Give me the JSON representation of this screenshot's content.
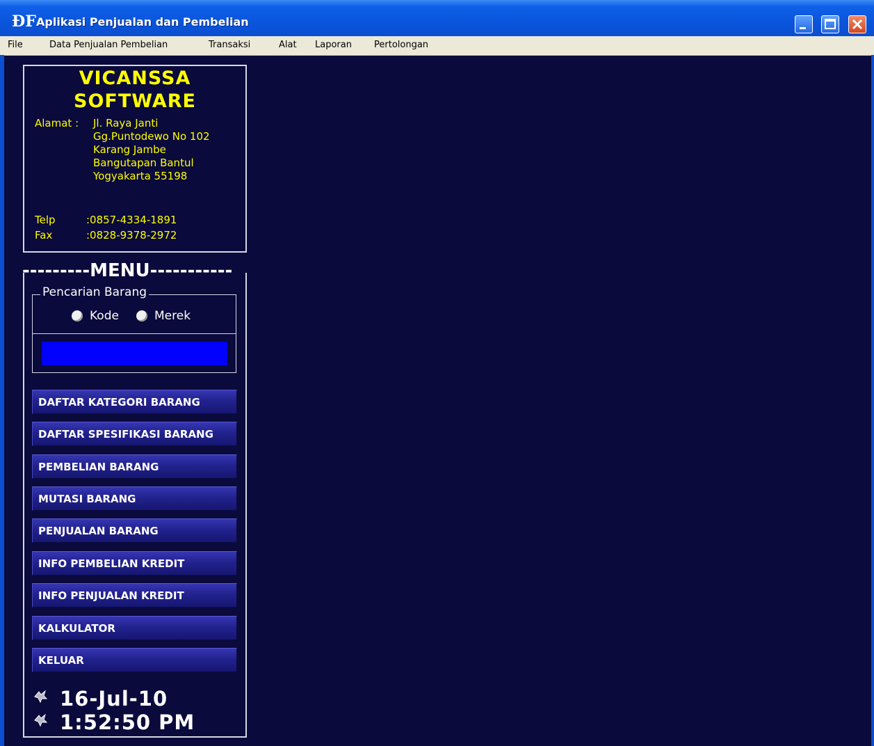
{
  "window": {
    "title": "Aplikasi Penjualan dan Pembelian",
    "icon_text": "ÐF"
  },
  "menubar": {
    "items": [
      "File",
      "Data Penjualan Pembelian",
      "Transaksi",
      "Alat",
      "Laporan",
      "Pertolongan"
    ]
  },
  "company": {
    "name_line1": "VICANSSA",
    "name_line2": "SOFTWARE",
    "address_label": "Alamat :",
    "address_lines": [
      "Jl. Raya Janti",
      "Gg.Puntodewo No 102",
      "Karang Jambe",
      "Bangutapan Bantul",
      "Yogyakarta 55198"
    ],
    "telp_label": "Telp",
    "telp_value": ":0857-4334-1891",
    "fax_label": "Fax",
    "fax_value": ":0828-9378-2972"
  },
  "menu": {
    "heading": "---------MENU-----------",
    "search": {
      "legend": "Pencarian Barang",
      "options": [
        "Kode",
        "Merek"
      ],
      "value": ""
    },
    "buttons": [
      "DAFTAR KATEGORI BARANG",
      "DAFTAR SPESIFIKASI BARANG",
      "PEMBELIAN BARANG",
      "MUTASI BARANG",
      "PENJUALAN BARANG",
      "INFO PEMBELIAN KREDIT",
      "INFO PENJUALAN KREDIT",
      "KALKULATOR",
      "KELUAR"
    ]
  },
  "status": {
    "date": "16-Jul-10",
    "time": "1:52:50 PM"
  },
  "colors": {
    "background": "#0a0a3c",
    "accent_text": "#ffff00",
    "search_field": "#0000ff",
    "titlebar": "#0b4ed0"
  }
}
